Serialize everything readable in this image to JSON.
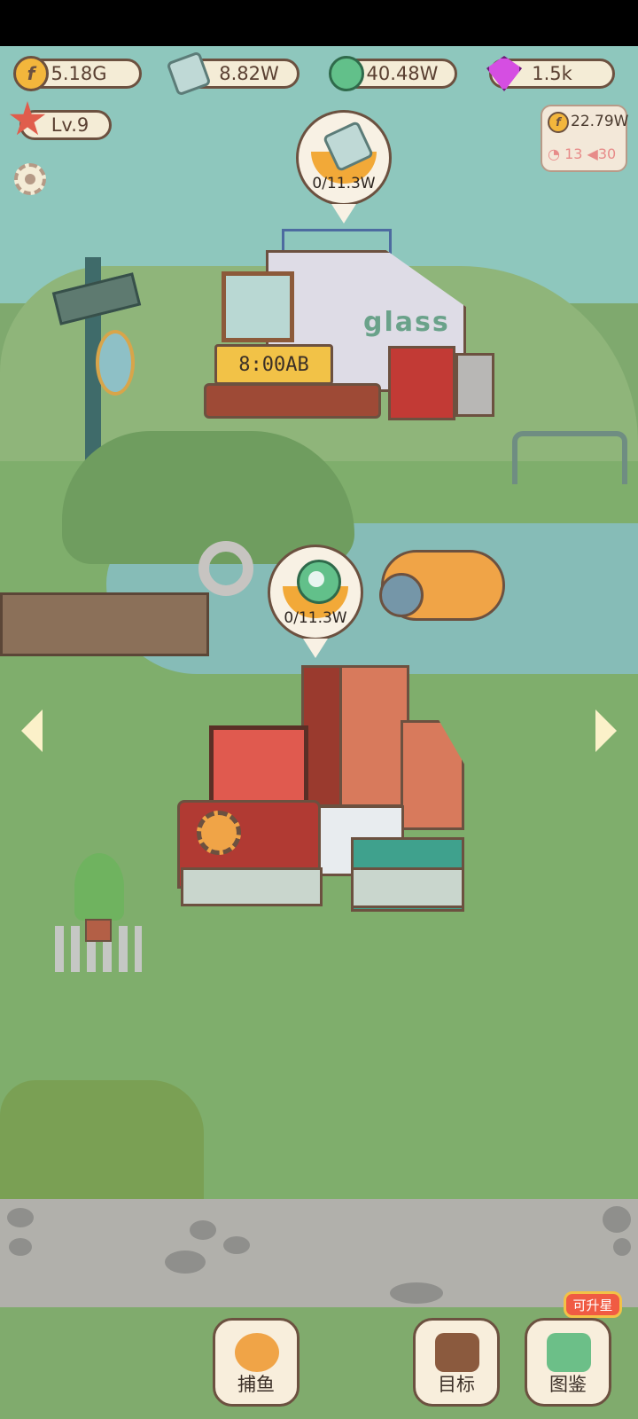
{
  "resources": {
    "coins": "5.18G",
    "glass": "8.82W",
    "cables": "40.48W",
    "gems": "1.5k"
  },
  "player": {
    "level": "Lv.9"
  },
  "income": {
    "rate": "22.79W",
    "fish_a": "13",
    "fish_b": "30"
  },
  "factories": [
    {
      "sign": "glass",
      "clock": "8:00AB",
      "progress": "0/11.3W"
    },
    {
      "progress": "0/11.3W"
    }
  ],
  "bottom_buttons": {
    "fishing": "捕鱼",
    "goals": "目标",
    "codex": "图鉴",
    "codex_badge": "可升星"
  },
  "colors": {
    "sky": "#8ec7bd",
    "grass": "#7fae6c",
    "accent_orange": "#f2a938",
    "outline_brown": "#6c5140"
  }
}
